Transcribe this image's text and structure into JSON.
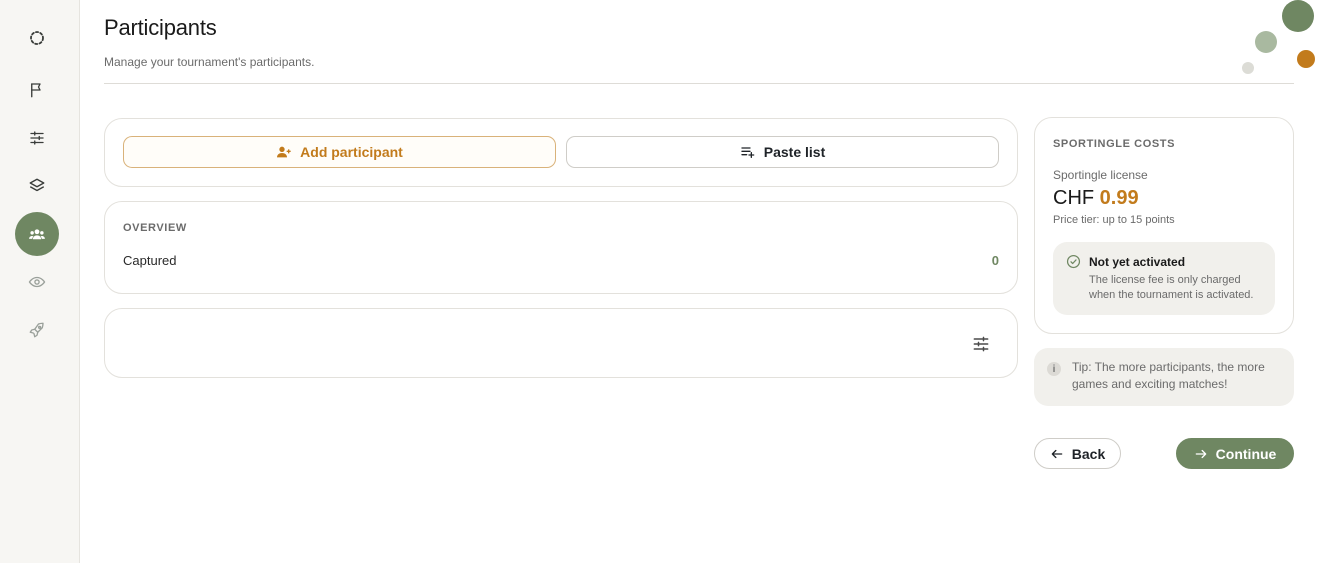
{
  "sidebar": {
    "items": [
      {
        "name": "logo",
        "icon": "loader-circle-icon"
      },
      {
        "name": "flag",
        "icon": "flag-icon"
      },
      {
        "name": "settings",
        "icon": "sliders-icon"
      },
      {
        "name": "layers",
        "icon": "layers-icon"
      },
      {
        "name": "participants",
        "icon": "users-icon",
        "active": true
      },
      {
        "name": "preview",
        "icon": "eye-icon"
      },
      {
        "name": "launch",
        "icon": "rocket-icon"
      }
    ]
  },
  "header": {
    "title": "Participants",
    "subtitle": "Manage your tournament's participants."
  },
  "actions": {
    "add_label": "Add participant",
    "paste_label": "Paste list"
  },
  "overview": {
    "title": "OVERVIEW",
    "captured_label": "Captured",
    "captured_value": "0"
  },
  "costs": {
    "title": "SPORTINGLE COSTS",
    "license_label": "Sportingle license",
    "currency": "CHF",
    "amount": "0.99",
    "tier": "Price tier: up to 15 points",
    "status_title": "Not yet activated",
    "status_desc": "The license fee is only charged when the tournament is activated."
  },
  "tip": {
    "icon": "i",
    "text": "Tip: The more participants, the more games and exciting matches!"
  },
  "nav": {
    "back_label": "Back",
    "continue_label": "Continue"
  },
  "colors": {
    "accent_green": "#6f8762",
    "accent_orange": "#c27b1c",
    "sidebar_bg": "#f7f6f3"
  }
}
